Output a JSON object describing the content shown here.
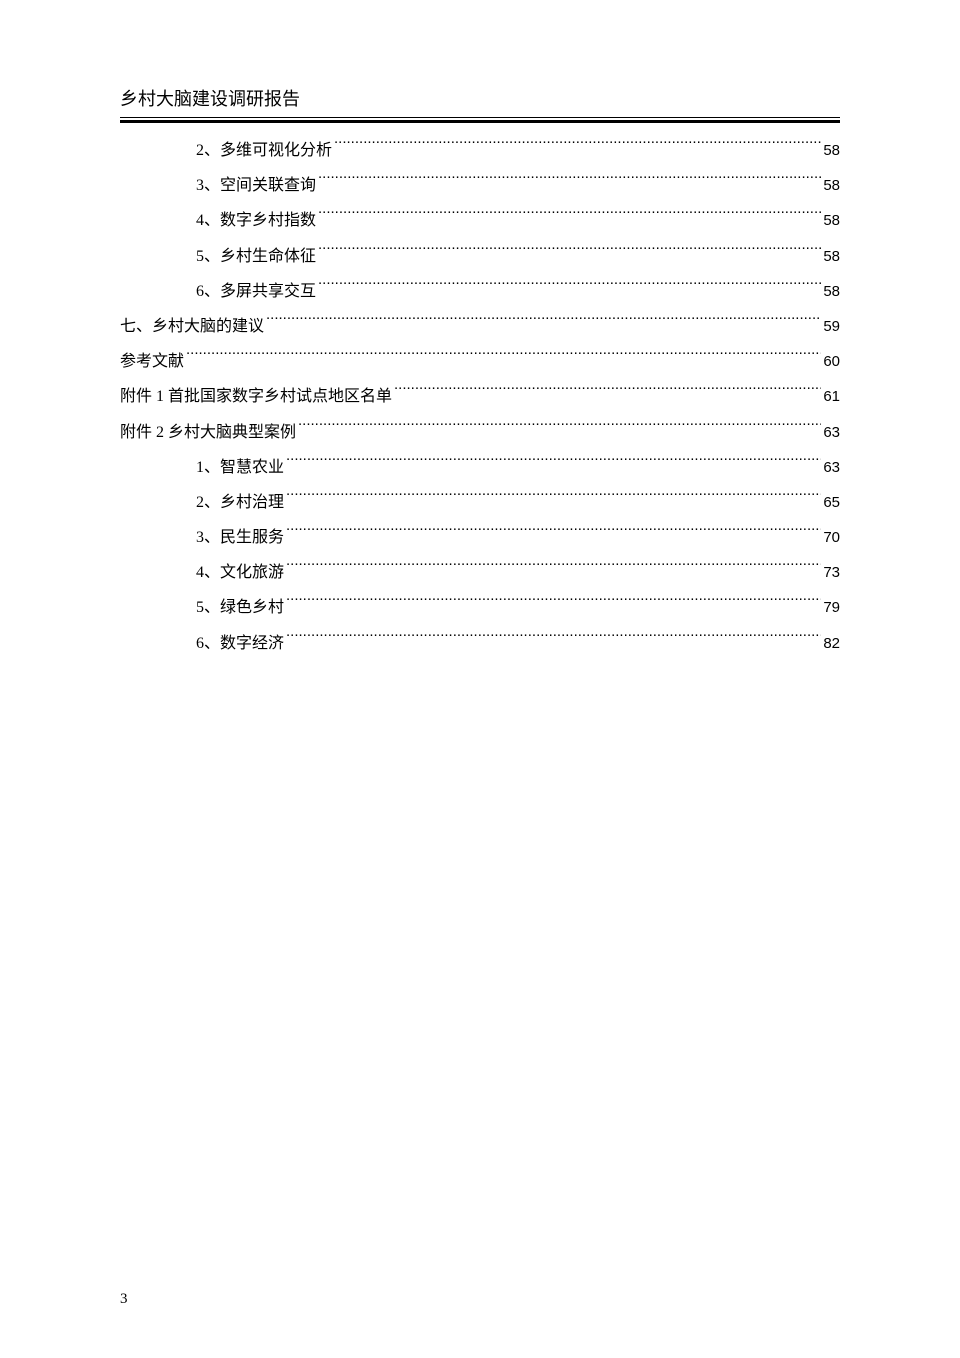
{
  "header": {
    "title": "乡村大脑建设调研报告"
  },
  "toc": [
    {
      "level": 2,
      "label": "2、多维可视化分析",
      "page": "58"
    },
    {
      "level": 2,
      "label": "3、空间关联查询",
      "page": "58"
    },
    {
      "level": 2,
      "label": "4、数字乡村指数",
      "page": "58"
    },
    {
      "level": 2,
      "label": "5、乡村生命体征",
      "page": "58"
    },
    {
      "level": 2,
      "label": "6、多屏共享交互",
      "page": "58"
    },
    {
      "level": 1,
      "label": "七、乡村大脑的建议",
      "page": "59"
    },
    {
      "level": 1,
      "label": "参考文献",
      "page": "60"
    },
    {
      "level": 1,
      "label": "附件 1  首批国家数字乡村试点地区名单",
      "page": "61"
    },
    {
      "level": 1,
      "label": "附件 2  乡村大脑典型案例",
      "page": "63"
    },
    {
      "level": 2,
      "label": "1、智慧农业",
      "page": "63"
    },
    {
      "level": 2,
      "label": "2、乡村治理",
      "page": "65"
    },
    {
      "level": 2,
      "label": "3、民生服务",
      "page": "70"
    },
    {
      "level": 2,
      "label": "4、文化旅游",
      "page": "73"
    },
    {
      "level": 2,
      "label": "5、绿色乡村",
      "page": "79"
    },
    {
      "level": 2,
      "label": "6、数字经济",
      "page": "82"
    }
  ],
  "footer": {
    "page_number": "3"
  }
}
